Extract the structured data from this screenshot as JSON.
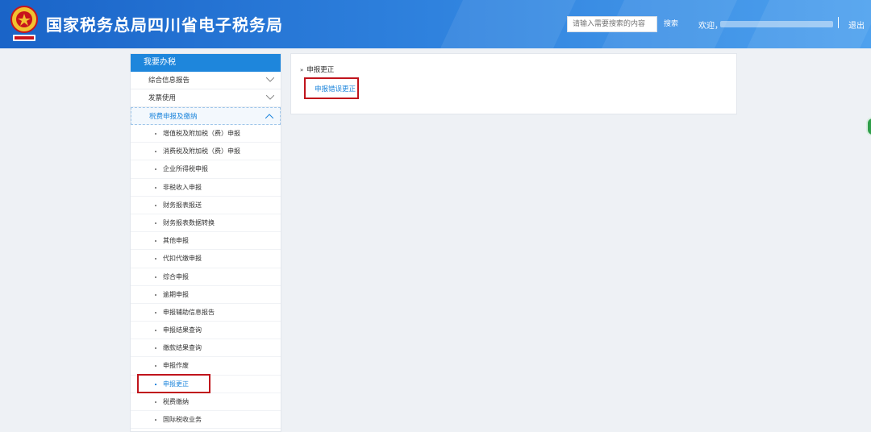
{
  "header": {
    "title": "国家税务总局四川省电子税务局",
    "emblem_icon": "tax-emblem-icon",
    "search": {
      "placeholder": "请输入需要搜索的内容",
      "button_label": "搜索"
    },
    "welcome_label": "欢迎，",
    "logout_label": "退出",
    "colors": {
      "gradient_start": "#1a64c8",
      "gradient_end": "#4ea1ee"
    }
  },
  "sidebar": {
    "title": "我要办税",
    "groups": [
      {
        "label": "综合信息报告",
        "expanded": false
      },
      {
        "label": "发票使用",
        "expanded": false
      },
      {
        "label": "税费申报及缴纳",
        "expanded": true
      }
    ],
    "items": [
      "增值税及附加税（费）申报",
      "消费税及附加税（费）申报",
      "企业所得税申报",
      "非税收入申报",
      "财务报表报送",
      "财务报表数据转换",
      "其他申报",
      "代扣代缴申报",
      "综合申报",
      "逾期申报",
      "申报辅助信息报告",
      "申报结果查询",
      "缴款结果查询",
      "申报作废",
      "申报更正",
      "税费缴纳",
      "国际税收业务"
    ],
    "selected_item": "申报更正"
  },
  "content": {
    "heading": "申报更正",
    "heading_bullet": "»",
    "link_label": "申报错误更正"
  },
  "colors": {
    "accent": "#1e86dc",
    "highlight_box": "#c0141c"
  }
}
